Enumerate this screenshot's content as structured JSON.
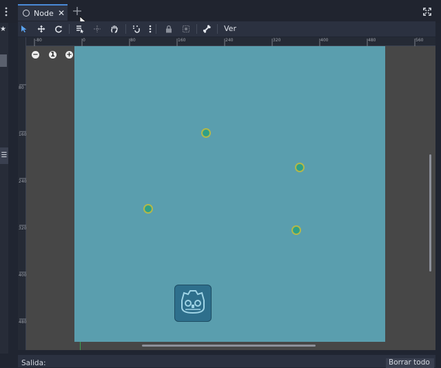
{
  "tabs": [
    {
      "label": "Node",
      "active": true,
      "close_icon": "close-icon"
    }
  ],
  "toolbar": {
    "view_menu_label": "Ver",
    "tools": [
      "select-icon",
      "move-icon",
      "rotate-icon",
      "list-select-icon",
      "pivot-icon",
      "pan-icon",
      "snap-icon",
      "more-vertical-icon",
      "lock-icon",
      "group-icon",
      "bone-icon"
    ]
  },
  "rulers": {
    "top": [
      "-80",
      "0",
      "80",
      "160",
      "240",
      "320",
      "400",
      "480",
      "560"
    ],
    "left": [
      "80",
      "160",
      "240",
      "320",
      "400",
      "480"
    ]
  },
  "zoom": {
    "reset_label": "1"
  },
  "output": {
    "label": "Salida:",
    "clear_label": "Borrar todo"
  },
  "colors": {
    "accent": "#4a8ad8",
    "scene_bg": "#5a9eae",
    "viewport_bg": "#474747",
    "panel_bg": "#2b3140"
  }
}
